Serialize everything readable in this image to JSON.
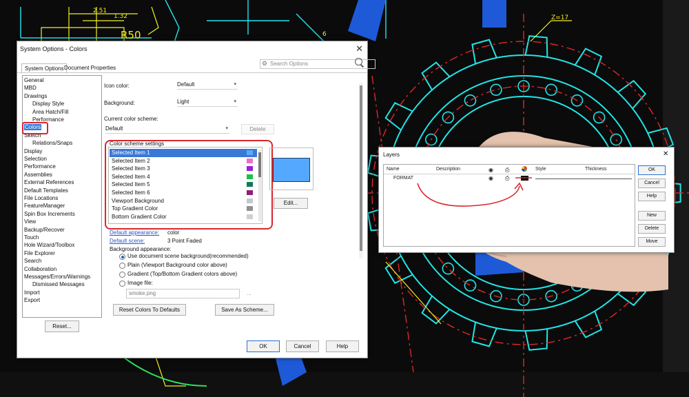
{
  "background": {
    "dimension_labels": [
      "2.51",
      "1.32",
      "R50",
      "Z=17",
      "6"
    ]
  },
  "system_options": {
    "title": "System Options - Colors",
    "close_symbol": "✕",
    "tabs": [
      "System Options",
      "Document Properties"
    ],
    "search_placeholder": "Search Options",
    "tree": [
      {
        "label": "General",
        "indent": 0
      },
      {
        "label": "MBD",
        "indent": 0
      },
      {
        "label": "Drawings",
        "indent": 0
      },
      {
        "label": "Display Style",
        "indent": 1
      },
      {
        "label": "Area Hatch/Fill",
        "indent": 1
      },
      {
        "label": "Performance",
        "indent": 1
      },
      {
        "label": "Colors",
        "indent": 0,
        "selected": true
      },
      {
        "label": "Sketch",
        "indent": 0
      },
      {
        "label": "Relations/Snaps",
        "indent": 1
      },
      {
        "label": "Display",
        "indent": 0
      },
      {
        "label": "Selection",
        "indent": 0
      },
      {
        "label": "Performance",
        "indent": 0
      },
      {
        "label": "Assemblies",
        "indent": 0
      },
      {
        "label": "External References",
        "indent": 0
      },
      {
        "label": "Default Templates",
        "indent": 0
      },
      {
        "label": "File Locations",
        "indent": 0
      },
      {
        "label": "FeatureManager",
        "indent": 0
      },
      {
        "label": "Spin Box Increments",
        "indent": 0
      },
      {
        "label": "View",
        "indent": 0
      },
      {
        "label": "Backup/Recover",
        "indent": 0
      },
      {
        "label": "Touch",
        "indent": 0
      },
      {
        "label": "Hole Wizard/Toolbox",
        "indent": 0
      },
      {
        "label": "File Explorer",
        "indent": 0
      },
      {
        "label": "Search",
        "indent": 0
      },
      {
        "label": "Collaboration",
        "indent": 0
      },
      {
        "label": "Messages/Errors/Warnings",
        "indent": 0
      },
      {
        "label": "Dismissed Messages",
        "indent": 1
      },
      {
        "label": "Import",
        "indent": 0
      },
      {
        "label": "Export",
        "indent": 0
      }
    ],
    "reset_button": "Reset...",
    "icon_color_label": "Icon color:",
    "icon_color_value": "Default",
    "background_label": "Background:",
    "background_value": "Light",
    "current_scheme_label": "Current color scheme:",
    "current_scheme_value": "Default",
    "delete_button": "Delete",
    "scheme_settings_label": "Color scheme settings",
    "scheme_items": [
      {
        "name": "Selected Item 1",
        "color": "#5aaaf2",
        "selected": true
      },
      {
        "name": "Selected Item 2",
        "color": "#f06ec8"
      },
      {
        "name": "Selected Item 3",
        "color": "#9a1ee0"
      },
      {
        "name": "Selected Item 4",
        "color": "#19c24a"
      },
      {
        "name": "Selected Item 5",
        "color": "#0e7a5c"
      },
      {
        "name": "Selected Item 6",
        "color": "#8e1e7a"
      },
      {
        "name": "Viewport Background",
        "color": "#c4c8cc"
      },
      {
        "name": "Top Gradient Color",
        "color": "#8d9096"
      },
      {
        "name": "Bottom Gradient Color",
        "color": "#cfcfcf"
      }
    ],
    "edit_button": "Edit...",
    "default_appearance_label": "Default appearance:",
    "default_appearance_value": "color",
    "default_scene_label": "Default scene:",
    "default_scene_value": "3 Point Faded",
    "background_appearance_label": "Background appearance:",
    "radios": [
      {
        "label": "Use document scene background(recommended)",
        "checked": true
      },
      {
        "label": "Plain (Viewport Background color above)",
        "checked": false
      },
      {
        "label": "Gradient (Top/Bottom Gradient colors above)",
        "checked": false
      },
      {
        "label": "Image file:",
        "checked": false
      }
    ],
    "image_file_value": "smoke.png",
    "browse_button": "...",
    "reset_colors_button": "Reset Colors To Defaults",
    "save_scheme_button": "Save As Scheme...",
    "ok_button": "OK",
    "cancel_button": "Cancel",
    "help_button": "Help",
    "preview_color": "#55a8ff",
    "selection_color": "#3a78d8",
    "annotation_color": "#d8262b"
  },
  "layers": {
    "title": "Layers",
    "close_symbol": "✕",
    "columns": [
      "Name",
      "Description",
      "Style",
      "Thickness"
    ],
    "column_icons": [
      "eye-icon",
      "printer-icon",
      "color-wheel-icon"
    ],
    "row": {
      "name": "FORMAT",
      "color": "#000000"
    },
    "buttons": [
      "OK",
      "Cancel",
      "Help",
      "New",
      "Delete",
      "Move"
    ]
  }
}
